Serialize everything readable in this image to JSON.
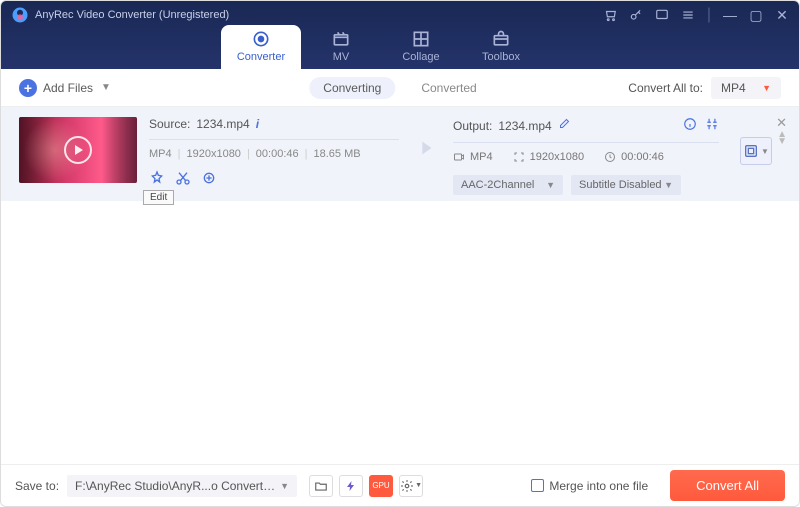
{
  "app_title": "AnyRec Video Converter (Unregistered)",
  "tabs": {
    "converter": "Converter",
    "mv": "MV",
    "collage": "Collage",
    "toolbox": "Toolbox"
  },
  "toolbar": {
    "add_files": "Add Files",
    "seg_converting": "Converting",
    "seg_converted": "Converted",
    "convert_all_to_label": "Convert All to:",
    "convert_all_to_value": "MP4"
  },
  "file": {
    "source_label": "Source:",
    "source_name": "1234.mp4",
    "src_format": "MP4",
    "src_resolution": "1920x1080",
    "src_duration": "00:00:46",
    "src_size": "18.65 MB",
    "edit_tooltip": "Edit",
    "output_label": "Output:",
    "output_name": "1234.mp4",
    "out_format": "MP4",
    "out_resolution": "1920x1080",
    "out_duration": "00:00:46",
    "audio_select": "AAC-2Channel",
    "subtitle_select": "Subtitle Disabled"
  },
  "bottom": {
    "save_to_label": "Save to:",
    "save_to_path": "F:\\AnyRec Studio\\AnyR...o Converter\\Converted",
    "merge_label": "Merge into one file",
    "convert_all_btn": "Convert All"
  }
}
